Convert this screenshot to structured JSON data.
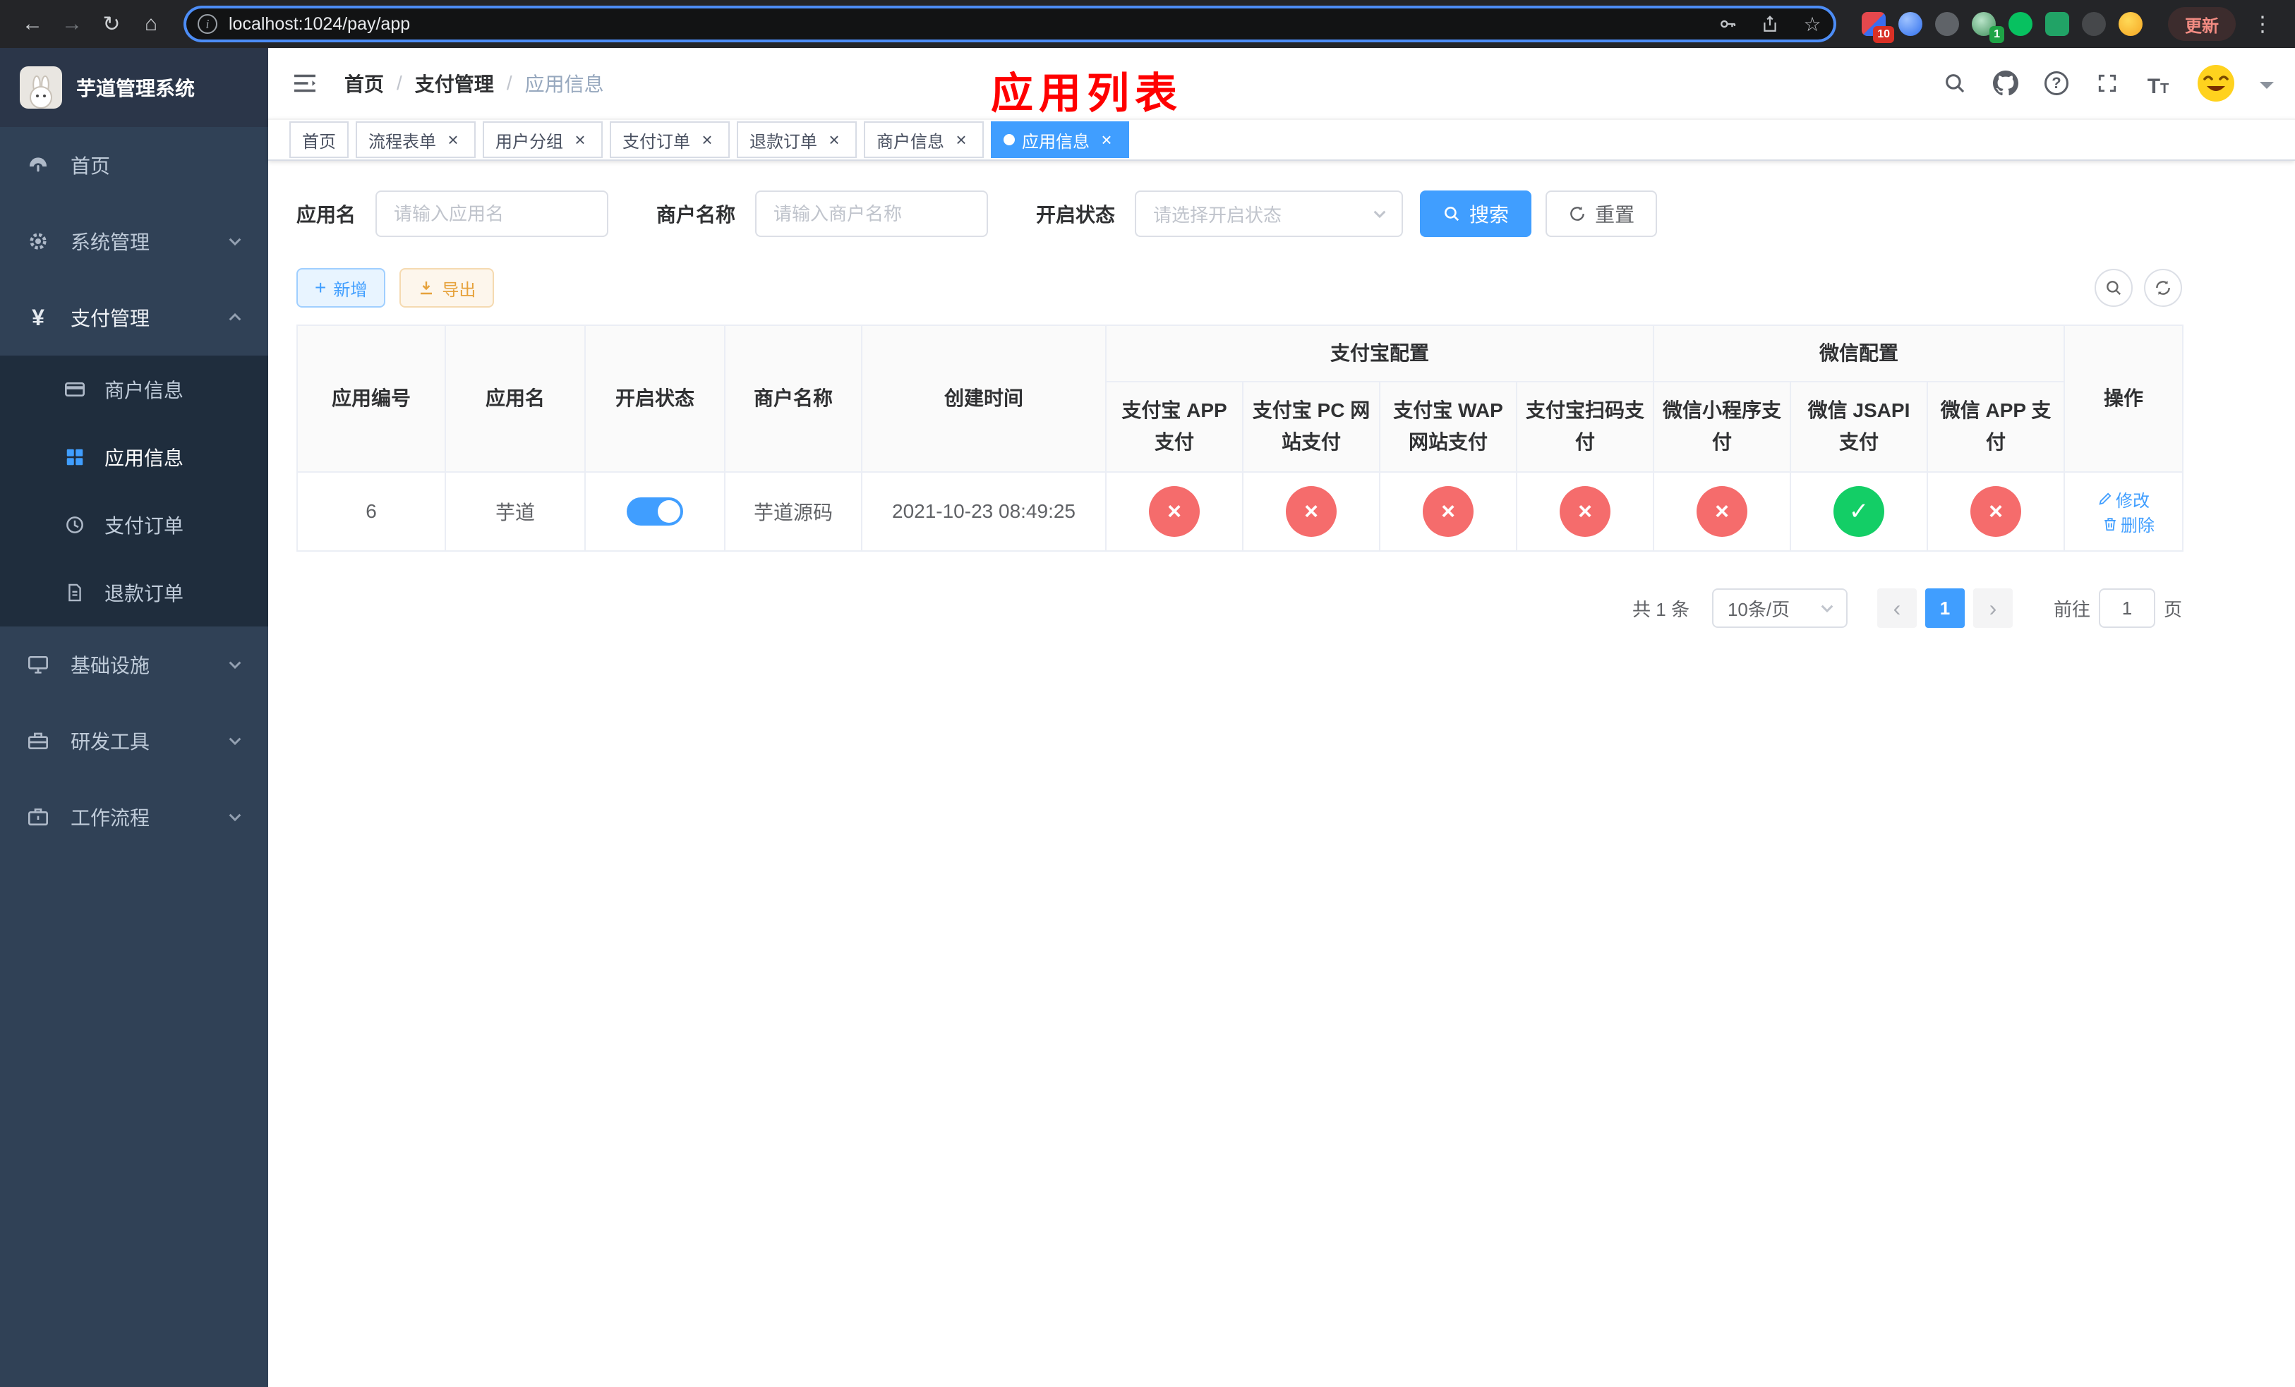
{
  "colors": {
    "accent_blue": "#409eff",
    "danger_red": "#f56c6c",
    "success_green": "#13ce66",
    "title_red": "#ff0000",
    "warning_orange": "#e6a23c",
    "sidebar_bg": "#304156",
    "submenu_bg": "#1f2d3d"
  },
  "icons": {
    "back": "←",
    "forward": "→",
    "reload": "↻",
    "home": "⌂",
    "star": "☆",
    "dots": "⋮",
    "slash": "/",
    "close": "×",
    "plus": "+",
    "prev": "‹",
    "next": "›",
    "check": "✓",
    "cross": "×",
    "info": "i",
    "question": "?"
  },
  "browser": {
    "url": "localhost:1024/pay/app",
    "update_button": "更新",
    "extension_badge_count": "10",
    "avatar_badge_count": "1"
  },
  "sidebar": {
    "app_title": "芋道管理系统",
    "home": "首页",
    "system": "系统管理",
    "payment": "支付管理",
    "merchant_info": "商户信息",
    "app_info": "应用信息",
    "pay_order": "支付订单",
    "refund_order": "退款订单",
    "infra": "基础设施",
    "devtools": "研发工具",
    "workflow": "工作流程"
  },
  "header": {
    "breadcrumb_home": "首页",
    "breadcrumb_payment": "支付管理",
    "breadcrumb_current": "应用信息",
    "page_title": "应用列表"
  },
  "tabs": [
    {
      "label": "首页"
    },
    {
      "label": "流程表单"
    },
    {
      "label": "用户分组"
    },
    {
      "label": "支付订单"
    },
    {
      "label": "退款订单"
    },
    {
      "label": "商户信息"
    },
    {
      "label": "应用信息"
    }
  ],
  "filters": {
    "app_name_label": "应用名",
    "app_name_placeholder": "请输入应用名",
    "merchant_label": "商户名称",
    "merchant_placeholder": "请输入商户名称",
    "status_label": "开启状态",
    "status_placeholder": "请选择开启状态",
    "search_button": "搜索",
    "reset_button": "重置"
  },
  "toolbar": {
    "add_button": "新增",
    "export_button": "导出"
  },
  "table": {
    "headers": {
      "app_id": "应用编号",
      "app_name": "应用名",
      "status": "开启状态",
      "merchant": "商户名称",
      "created": "创建时间",
      "alipay_group": "支付宝配置",
      "wechat_group": "微信配置",
      "actions": "操作",
      "alipay_cols": [
        "支付宝 APP 支付",
        "支付宝 PC 网站支付",
        "支付宝 WAP 网站支付",
        "支付宝扫码支付"
      ],
      "wechat_cols": [
        "微信小程序支付",
        "微信 JSAPI 支付",
        "微信 APP 支付"
      ]
    },
    "rows": [
      {
        "app_id": "6",
        "app_name": "芋道",
        "status_on": true,
        "merchant": "芋道源码",
        "created": "2021-10-23 08:49:25",
        "channels": [
          "no",
          "no",
          "no",
          "no",
          "no",
          "yes",
          "no"
        ],
        "edit_label": "修改",
        "delete_label": "删除"
      }
    ]
  },
  "pagination": {
    "total": "共 1 条",
    "page_size": "10条/页",
    "current_page": "1",
    "goto_prefix": "前往",
    "goto_value": "1",
    "goto_suffix": "页"
  }
}
